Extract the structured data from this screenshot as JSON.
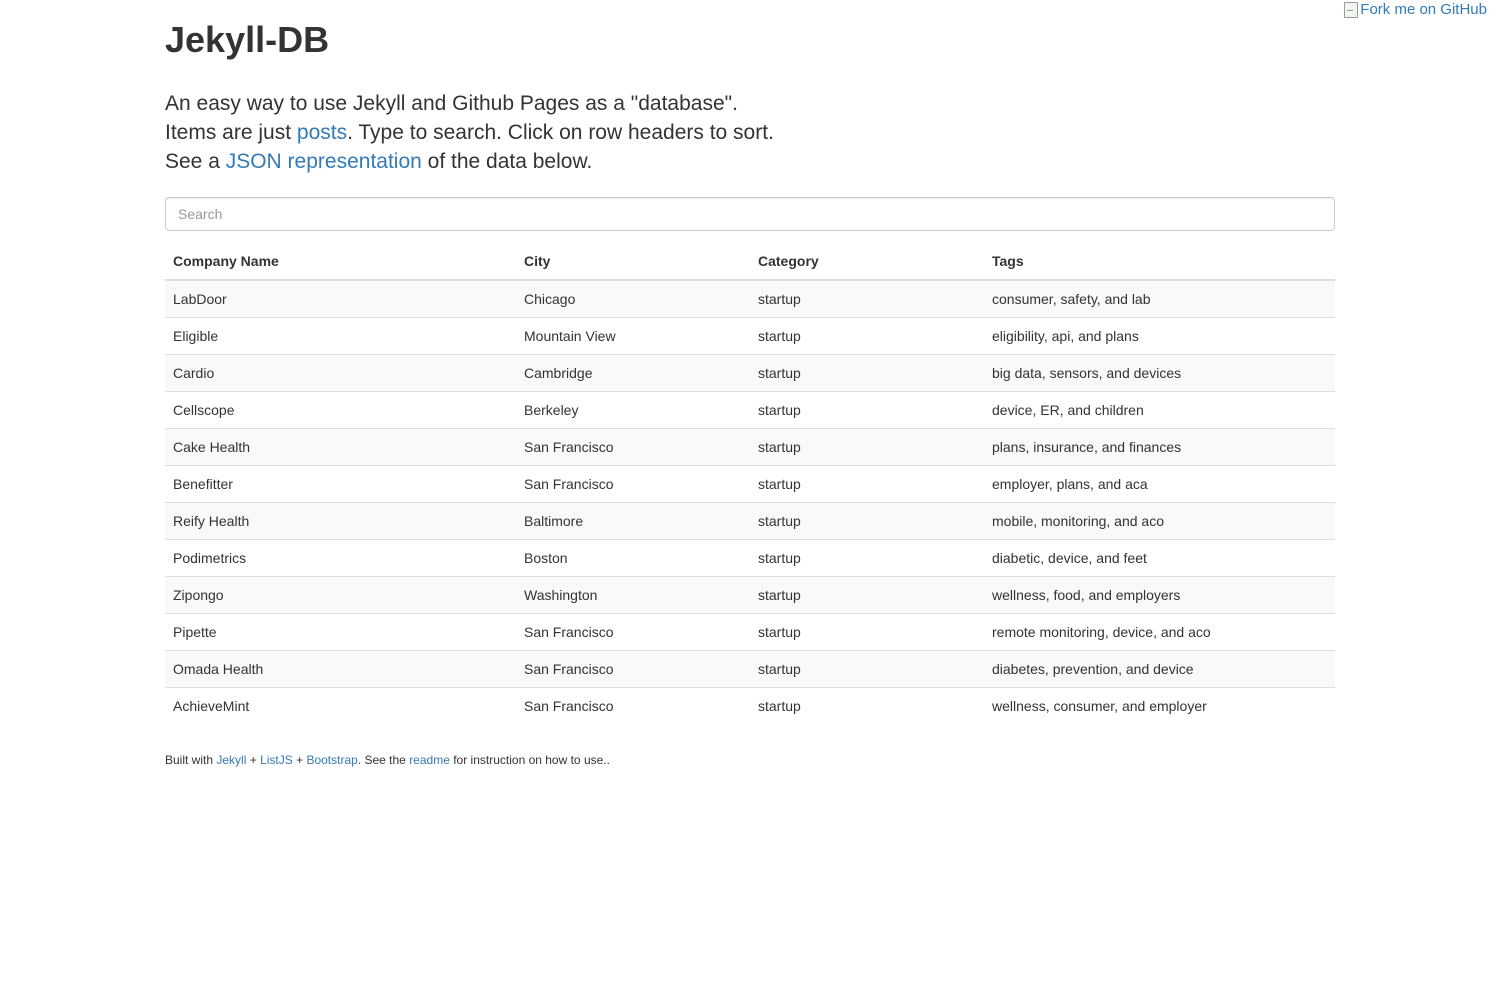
{
  "ribbon": {
    "alt_text": "Fork me on GitHub"
  },
  "header": {
    "title": "Jekyll-DB",
    "line1": "An easy way to use Jekyll and Github Pages as a \"database\".",
    "line2_prefix": "Items are just ",
    "line2_link": "posts",
    "line2_suffix": ". Type to search. Click on row headers to sort.",
    "line3_prefix": "See a ",
    "line3_link": "JSON representation",
    "line3_suffix": " of the data below."
  },
  "search": {
    "placeholder": "Search",
    "value": ""
  },
  "table": {
    "columns": [
      "Company Name",
      "City",
      "Category",
      "Tags"
    ],
    "rows": [
      [
        "LabDoor",
        "Chicago",
        "startup",
        "consumer, safety, and lab"
      ],
      [
        "Eligible",
        "Mountain View",
        "startup",
        "eligibility, api, and plans"
      ],
      [
        "Cardio",
        "Cambridge",
        "startup",
        "big data, sensors, and devices"
      ],
      [
        "Cellscope",
        "Berkeley",
        "startup",
        "device, ER, and children"
      ],
      [
        "Cake Health",
        "San Francisco",
        "startup",
        "plans, insurance, and finances"
      ],
      [
        "Benefitter",
        "San Francisco",
        "startup",
        "employer, plans, and aca"
      ],
      [
        "Reify Health",
        "Baltimore",
        "startup",
        "mobile, monitoring, and aco"
      ],
      [
        "Podimetrics",
        "Boston",
        "startup",
        "diabetic, device, and feet"
      ],
      [
        "Zipongo",
        "Washington",
        "startup",
        "wellness, food, and employers"
      ],
      [
        "Pipette",
        "San Francisco",
        "startup",
        "remote monitoring, device, and aco"
      ],
      [
        "Omada Health",
        "San Francisco",
        "startup",
        "diabetes, prevention, and device"
      ],
      [
        "AchieveMint",
        "San Francisco",
        "startup",
        "wellness, consumer, and employer"
      ]
    ]
  },
  "footer": {
    "prefix": "Built with ",
    "link_jekyll": "Jekyll",
    "plus1": " + ",
    "link_listjs": "ListJS",
    "plus2": " + ",
    "link_bootstrap": "Bootstrap",
    "middle": ". See the ",
    "link_readme": "readme",
    "suffix": " for instruction on how to use.."
  },
  "colors": {
    "link": "#337ab7",
    "text": "#333333",
    "stripe": "#f9f9f9",
    "border": "#dddddd"
  }
}
